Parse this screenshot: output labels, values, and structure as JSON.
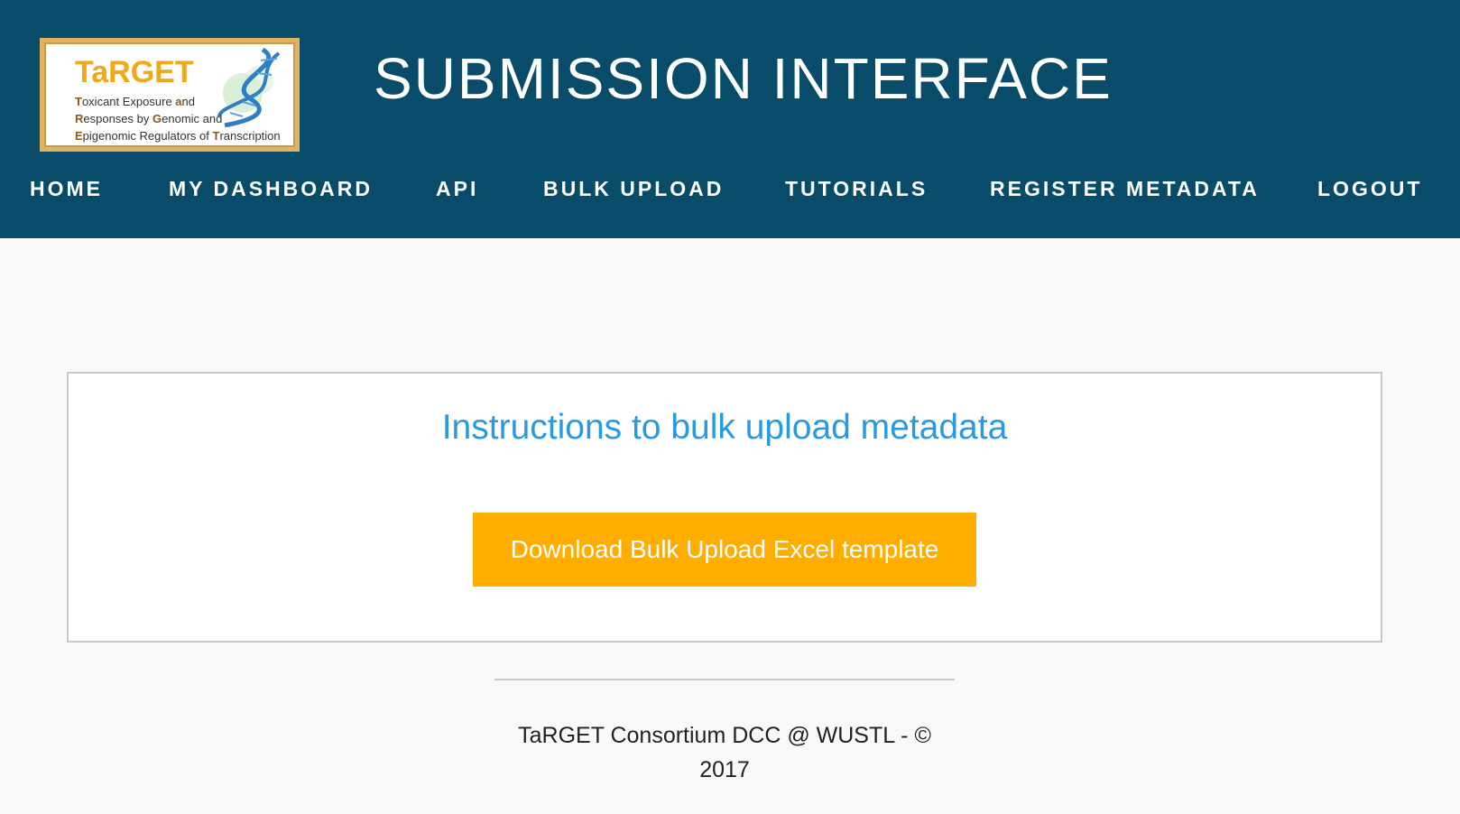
{
  "header": {
    "logo": {
      "title": "TaRGET",
      "lines": [
        {
          "first": "T",
          "rest": "oxicant Exposure ",
          "and_first": "a",
          "and_rest": "nd"
        },
        {
          "first": "R",
          "rest": "esponses by ",
          "mid_first": "G",
          "mid_rest": "enomic and"
        },
        {
          "first": "E",
          "rest": "pigenomic Regulators of ",
          "end_first": "T",
          "end_rest": "ranscription"
        }
      ]
    },
    "title": "SUBMISSION INTERFACE",
    "nav": [
      "HOME",
      "MY DASHBOARD",
      "API",
      "BULK UPLOAD",
      "TUTORIALS",
      "REGISTER METADATA",
      "LOGOUT"
    ]
  },
  "main": {
    "heading": "Instructions to bulk upload metadata",
    "download_button": "Download Bulk Upload Excel template"
  },
  "footer": {
    "line1": "TaRGET Consortium DCC @ WUSTL - ©",
    "line2": "2017"
  },
  "colors": {
    "header_bg": "#084c69",
    "accent": "#ffae00",
    "heading": "#2a9ae0"
  }
}
